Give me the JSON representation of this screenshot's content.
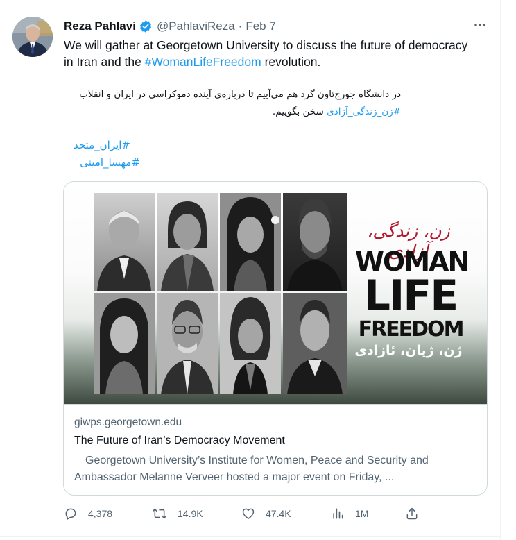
{
  "author": {
    "name": "Reza Pahlavi",
    "handle": "@PahlaviReza",
    "separator": "·",
    "date": "Feb 7"
  },
  "tweet": {
    "text_en_before": "We will gather at Georgetown University to discuss the future of democracy in Iran and the ",
    "hashtag_en": "#WomanLifeFreedom",
    "text_en_after": " revolution.",
    "text_fa_line1": "در دانشگاه جورج‌تاون گرد هم می‌آییم تا درباره‌ی آینده دموکراسی در ایران و انقلاب",
    "hashtag_fa_inline": "#زن_زندگی_آزادی",
    "text_fa_line2_after": " سخن بگوییم.",
    "hashtag_fa_1": "#ایران_متحد",
    "hashtag_fa_2": "#مهسا_امینی"
  },
  "card": {
    "poster": {
      "persian_top": "زن، زندگی، آزادی",
      "word1": "WOMAN",
      "word2": "LIFE",
      "word3": "FREEDOM",
      "kurdish_bottom": "ژن، ژیان، ئازادی"
    },
    "domain": "giwps.georgetown.edu",
    "title": "The Future of Iran’s Democracy Movement",
    "description": "Georgetown University’s Institute for Women, Peace and Security and Ambassador Melanne Verveer hosted a major event on Friday, ..."
  },
  "actions": {
    "replies": "4,378",
    "retweets": "14.9K",
    "likes": "47.4K",
    "views": "1M"
  },
  "colors": {
    "accent": "#1d9bf0",
    "muted": "#536471",
    "poster_red": "#b3152a"
  },
  "icons": [
    "verified-badge-icon",
    "more-icon",
    "reply-icon",
    "retweet-icon",
    "like-icon",
    "views-icon",
    "share-icon"
  ]
}
